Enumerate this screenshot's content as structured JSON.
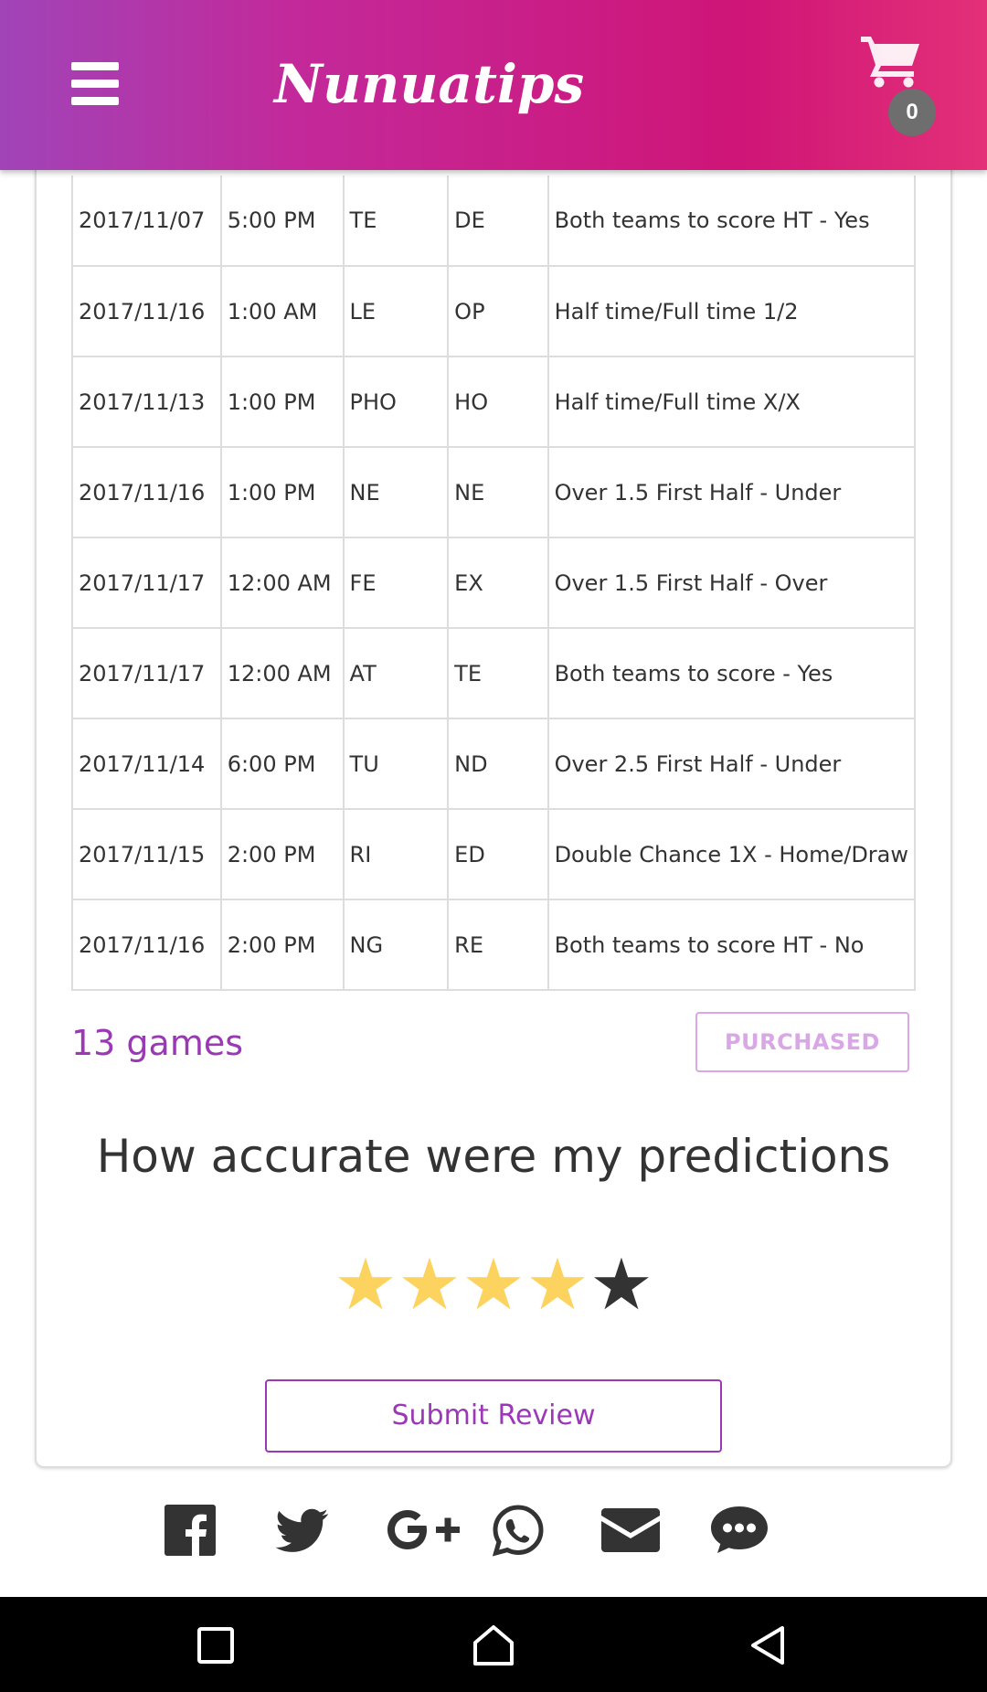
{
  "header": {
    "brand": "Nunuatips",
    "cart_count": "0",
    "colors": {
      "gradient_start": "#a044b8",
      "gradient_mid": "#cf1577",
      "gradient_end": "#e33078"
    },
    "icons": [
      "menu-icon",
      "cart-icon"
    ]
  },
  "tips": {
    "rows": [
      [
        "2017/11/07",
        "5:00 PM",
        "TE",
        "DE",
        "Both teams to score HT - Yes"
      ],
      [
        "2017/11/16",
        "1:00 AM",
        "LE",
        "OP",
        "Half time/Full time 1/2"
      ],
      [
        "2017/11/13",
        "1:00 PM",
        "PHO",
        "HO",
        "Half time/Full time X/X"
      ],
      [
        "2017/11/16",
        "1:00 PM",
        "NE",
        "NE",
        "Over 1.5 First Half - Under"
      ],
      [
        "2017/11/17",
        "12:00 AM",
        "FE",
        "EX",
        "Over 1.5 First Half - Over"
      ],
      [
        "2017/11/17",
        "12:00 AM",
        "AT",
        "TE",
        "Both teams to score - Yes"
      ],
      [
        "2017/11/14",
        "6:00 PM",
        "TU",
        "ND",
        "Over 2.5 First Half - Under"
      ],
      [
        "2017/11/15",
        "2:00 PM",
        "RI",
        "ED",
        "Double Chance 1X - Home/Draw"
      ],
      [
        "2017/11/16",
        "2:00 PM",
        "NG",
        "RE",
        "Both teams to score HT - No"
      ]
    ]
  },
  "summary": {
    "games_count": "13 games",
    "purchased_label": "PURCHASED"
  },
  "review": {
    "title": "How accurate were my predictions",
    "rating": 4,
    "max_rating": 5,
    "star_char": "★",
    "submit_label": "Submit Review",
    "colors": {
      "star_on": "#fcd35e",
      "star_off": "#333333",
      "accent": "#9b38b6"
    }
  },
  "share": {
    "icons": [
      "facebook-icon",
      "twitter-icon",
      "google-plus-icon",
      "whatsapp-icon",
      "email-icon",
      "chat-icon"
    ]
  },
  "system_nav": {
    "icons": [
      "recents-icon",
      "home-icon",
      "back-icon"
    ]
  }
}
